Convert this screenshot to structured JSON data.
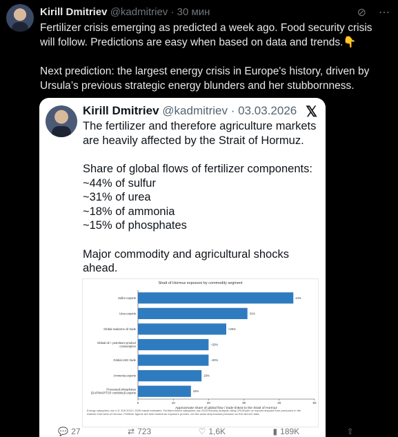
{
  "post": {
    "author_name": "Kirill Dmitriev",
    "handle": "@kadmitriev",
    "sep": "·",
    "time": "30 мин",
    "text": "Fertilizer crisis emerging as predicted a week ago. Food security crisis will follow. Predictions are easy when based on data and trends.👇\n\nNext prediction: the largest energy crisis in Europe's history, driven by Ursula’s previous strategic energy blunders and her stubbornness."
  },
  "quote": {
    "author_name": "Kirill Dmitriev",
    "handle": "@kadmitriev",
    "sep": "·",
    "date": "03.03.2026",
    "para1": "The fertilizer and therefore agriculture markets are heavily affected by the Strait of Hormuz.",
    "para2": "Share of global flows of fertilizer components:\n~44% of sulfur\n~31% of urea\n~18% of ammonia\n~15% of phosphates",
    "para3": "Major commodity and agricultural shocks ahead."
  },
  "chart_data": {
    "type": "bar",
    "orientation": "horizontal",
    "title": "Strait of Hormuz exposure by commodity segment",
    "xlabel": "Approximate share of global flow / trade linked to the Strait of Hormuz",
    "xlim": [
      0,
      50
    ],
    "xticks": [
      0,
      10,
      20,
      30,
      40,
      50
    ],
    "categories": [
      "Sulfur exports",
      "Urea exports",
      "Global seaborne oil trade",
      "Global oil + petroleum product consumption",
      "Global LNG trade",
      "Ammonia exports",
      "Processed phosphates (DAP/MAP/TSP combined) exports"
    ],
    "values": [
      44,
      31,
      25,
      20,
      20,
      18,
      15
    ],
    "value_labels": [
      "44%",
      "31%",
      ">25%",
      "~20%",
      "~20%",
      "18%",
      "15%"
    ],
    "bar_color": "#2f7bbf",
    "notes": "Energy categories use U.S. EIA 2024 / 2025 transit estimates. Fertilizer-linked categories use 2025 industry analysis citing CRU/Kpler on exports shipped from producers in the Arabian Gulf west of Hormuz. Fertilizer figures are best treated as exposure proxies, not the same strip-tracked precision as EIA oil/LNG data."
  },
  "actions": {
    "replies": "27",
    "reposts": "723",
    "likes": "1,6K",
    "views": "189K"
  },
  "colors": {
    "background": "#000000",
    "text": "#e7e9ea",
    "muted": "#71767b"
  }
}
